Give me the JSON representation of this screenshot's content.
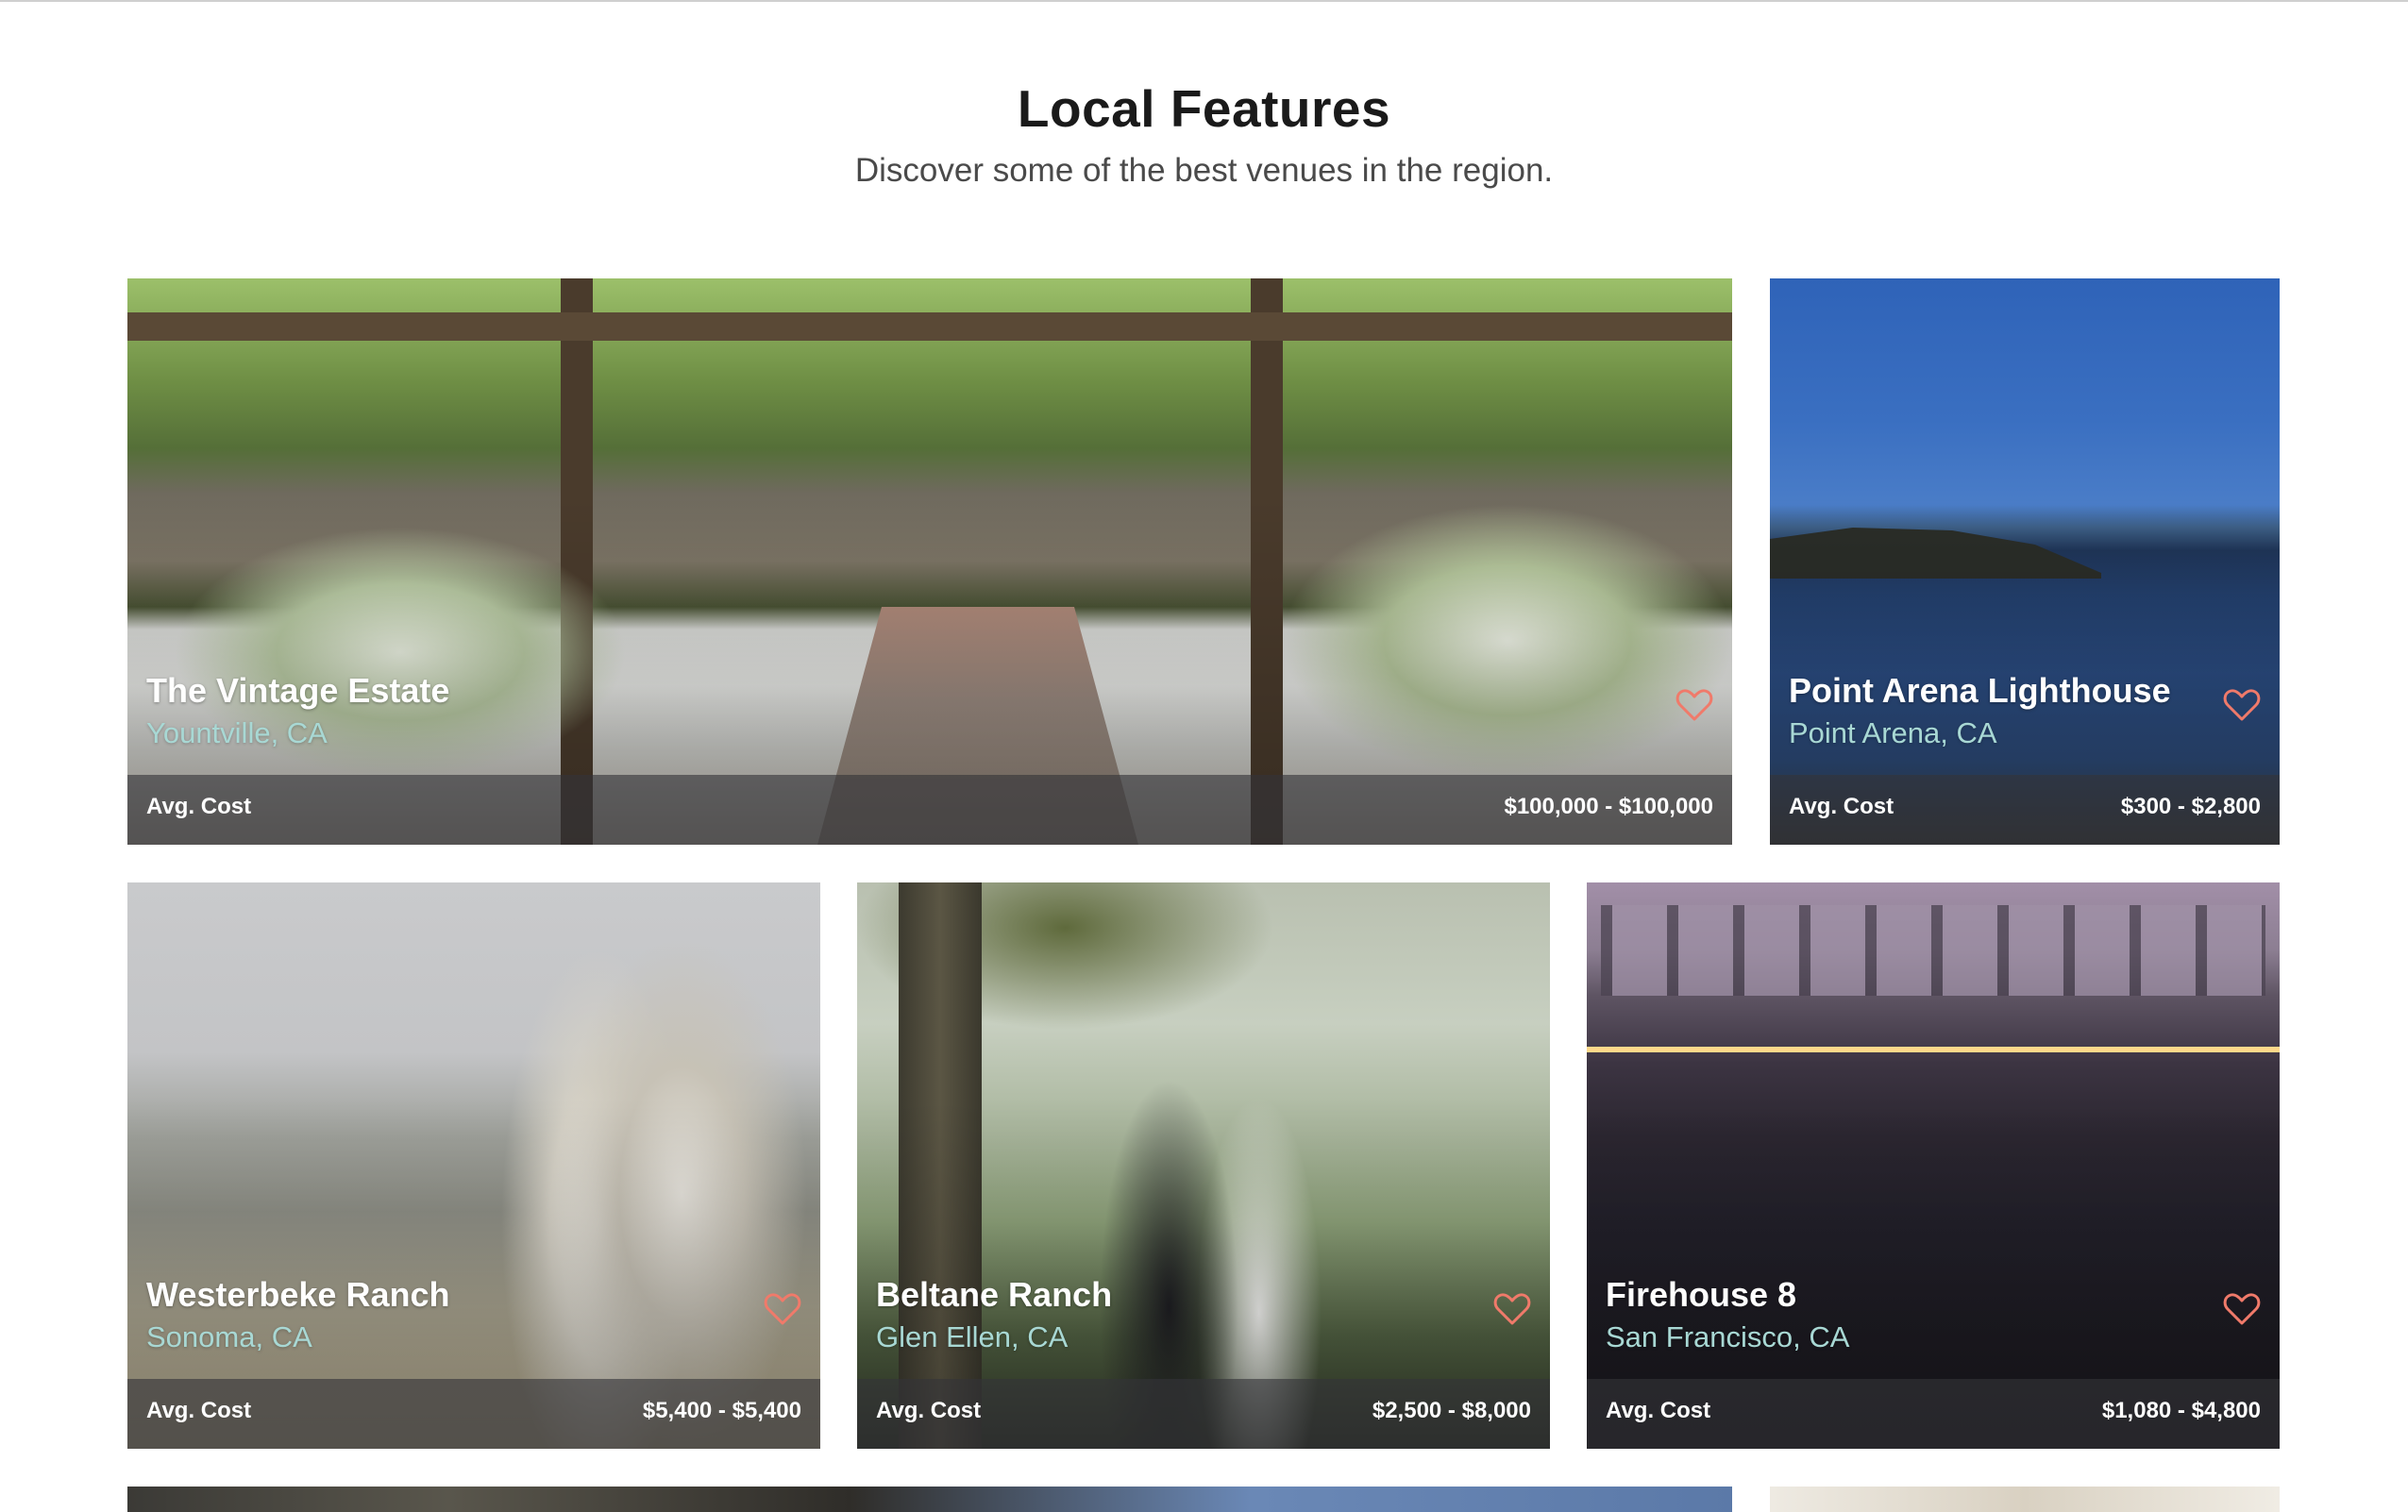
{
  "section": {
    "title": "Local Features",
    "subtitle": "Discover some of the best venues in the region."
  },
  "theme": {
    "heart_color": "#f07a6a",
    "location_color": "#a8d8d4",
    "cost_bar_color": "#343438"
  },
  "venues": [
    {
      "name": "The Vintage Estate",
      "location": "Yountville, CA",
      "cost_label": "Avg. Cost",
      "cost": "$100,000 - $100,000",
      "favorite_icon": "heart-outline-icon"
    },
    {
      "name": "Point Arena Lighthouse",
      "location": "Point Arena, CA",
      "cost_label": "Avg. Cost",
      "cost": "$300 - $2,800",
      "favorite_icon": "heart-outline-icon"
    },
    {
      "name": "Westerbeke Ranch",
      "location": "Sonoma, CA",
      "cost_label": "Avg. Cost",
      "cost": "$5,400 - $5,400",
      "favorite_icon": "heart-outline-icon"
    },
    {
      "name": "Beltane Ranch",
      "location": "Glen Ellen, CA",
      "cost_label": "Avg. Cost",
      "cost": "$2,500 - $8,000",
      "favorite_icon": "heart-outline-icon"
    },
    {
      "name": "Firehouse 8",
      "location": "San Francisco, CA",
      "cost_label": "Avg. Cost",
      "cost": "$1,080 - $4,800",
      "favorite_icon": "heart-outline-icon"
    }
  ]
}
